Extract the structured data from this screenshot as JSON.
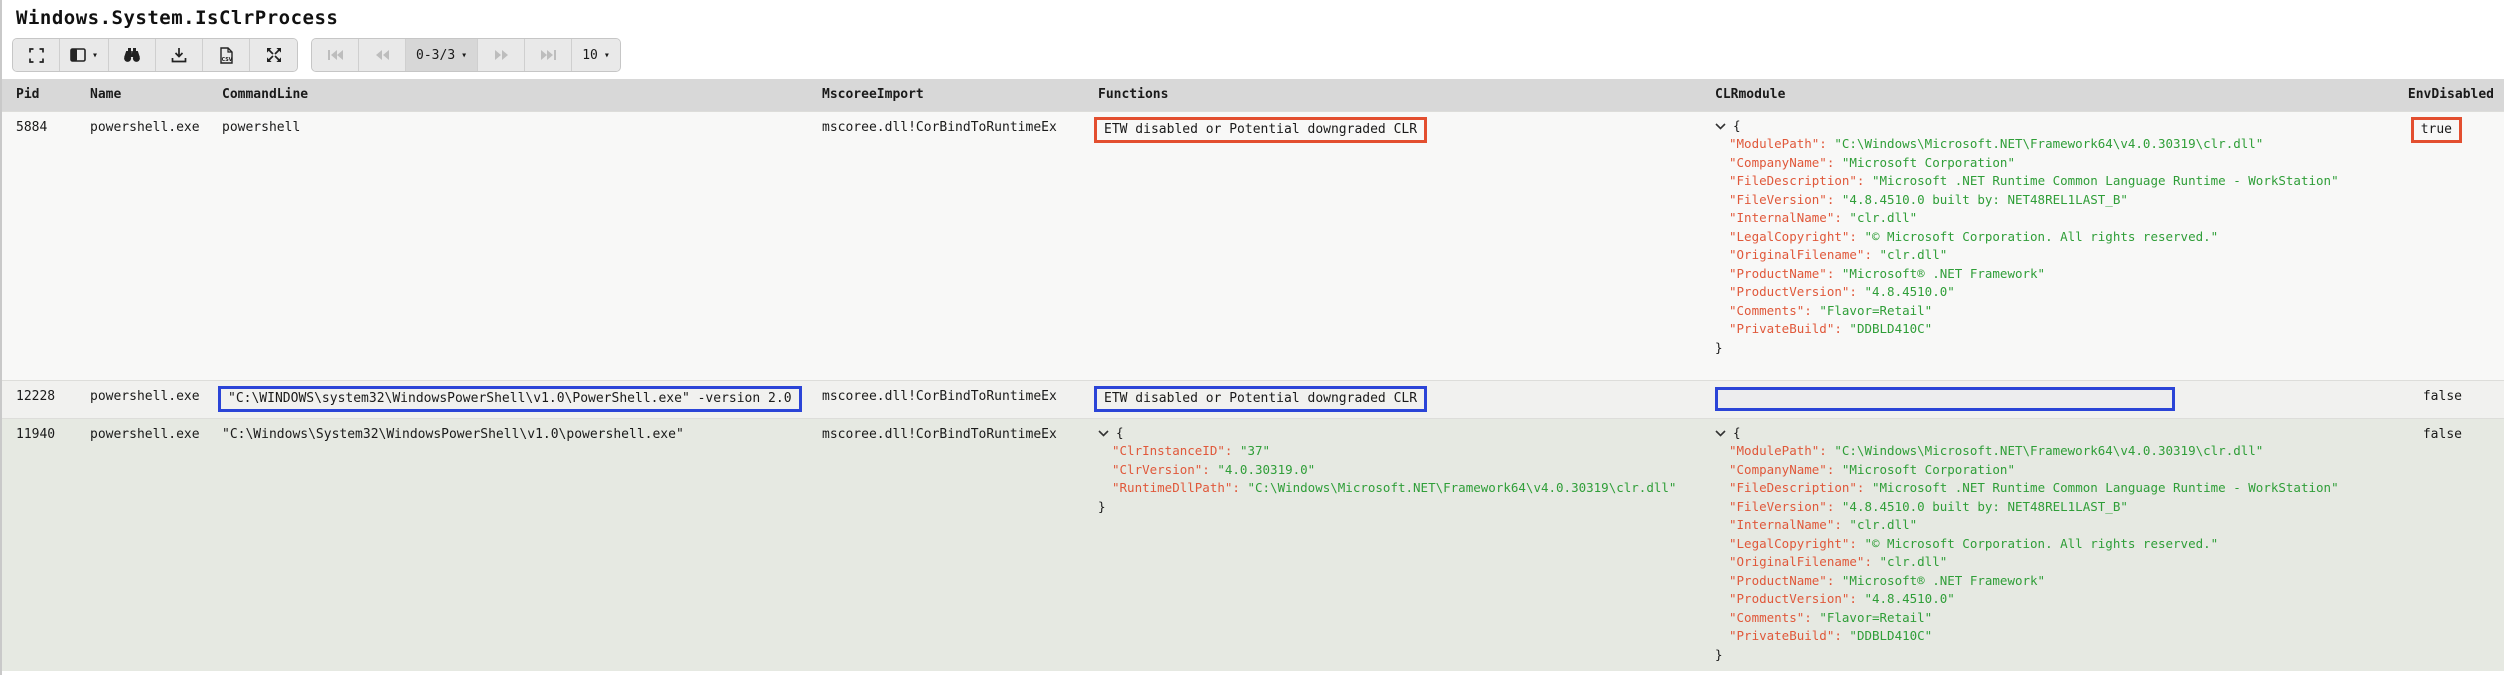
{
  "title": "Windows.System.IsClrProcess",
  "icons": {
    "caret_down": "▾"
  },
  "colors": {
    "flag_red": "#e34f2f",
    "flag_blue": "#2b44d7",
    "json_key": "#e0583a",
    "json_value": "#2f9e38",
    "header_bg": "#d8d8d8",
    "row3_bg": "#e6e9e2"
  },
  "toolbar": {
    "buttons": [
      {
        "name": "fullscreen",
        "icon": "fullscreen-icon"
      },
      {
        "name": "columns",
        "icon": "columns-icon"
      },
      {
        "name": "search",
        "icon": "binoculars-icon"
      },
      {
        "name": "download",
        "icon": "download-icon"
      },
      {
        "name": "export-csv",
        "icon": "csv-file-icon"
      },
      {
        "name": "expand",
        "icon": "arrows-expand-icon"
      }
    ],
    "pagination": {
      "range_label": "0-3/3",
      "page_size_label": "10"
    }
  },
  "table": {
    "columns": [
      "Pid",
      "Name",
      "CommandLine",
      "MscoreeImport",
      "Functions",
      "CLRmodule",
      "EnvDisabled"
    ],
    "rows": [
      {
        "pid": "5884",
        "name": "powershell.exe",
        "commandline": {
          "text": "powershell",
          "box": null
        },
        "mscoree": "mscoree.dll!CorBindToRuntimeEx",
        "functions": {
          "text": "ETW disabled or Potential downgraded CLR",
          "box": "red"
        },
        "clrmodule": {
          "json": [
            {
              "k": "ModulePath",
              "v": "C:\\Windows\\Microsoft.NET\\Framework64\\v4.0.30319\\clr.dll"
            },
            {
              "k": "CompanyName",
              "v": "Microsoft Corporation"
            },
            {
              "k": "FileDescription",
              "v": "Microsoft .NET Runtime Common Language Runtime - WorkStation"
            },
            {
              "k": "FileVersion",
              "v": "4.8.4510.0 built by: NET48REL1LAST_B"
            },
            {
              "k": "InternalName",
              "v": "clr.dll"
            },
            {
              "k": "LegalCopyright",
              "v": "© Microsoft Corporation. All rights reserved."
            },
            {
              "k": "OriginalFilename",
              "v": "clr.dll"
            },
            {
              "k": "ProductName",
              "v": "Microsoft® .NET Framework"
            },
            {
              "k": "ProductVersion",
              "v": "4.8.4510.0"
            },
            {
              "k": "Comments",
              "v": "Flavor=Retail"
            },
            {
              "k": "PrivateBuild",
              "v": "DDBLD410C"
            }
          ]
        },
        "envdisabled": {
          "text": "true",
          "box": "red"
        }
      },
      {
        "pid": "12228",
        "name": "powershell.exe",
        "commandline": {
          "text": "\"C:\\WINDOWS\\system32\\WindowsPowerShell\\v1.0\\PowerShell.exe\" -version 2.0",
          "box": "blue"
        },
        "mscoree": "mscoree.dll!CorBindToRuntimeEx",
        "functions": {
          "text": "ETW disabled or Potential downgraded CLR",
          "box": "blue"
        },
        "clrmodule": {
          "empty_box": "blue"
        },
        "envdisabled": {
          "text": "false",
          "box": null
        }
      },
      {
        "pid": "11940",
        "name": "powershell.exe",
        "commandline": {
          "text": "\"C:\\Windows\\System32\\WindowsPowerShell\\v1.0\\powershell.exe\"",
          "box": null
        },
        "mscoree": "mscoree.dll!CorBindToRuntimeEx",
        "functions": {
          "json": [
            {
              "k": "ClrInstanceID",
              "v": "37"
            },
            {
              "k": "ClrVersion",
              "v": "4.0.30319.0"
            },
            {
              "k": "RuntimeDllPath",
              "v": "C:\\Windows\\Microsoft.NET\\Framework64\\v4.0.30319\\clr.dll"
            }
          ]
        },
        "clrmodule": {
          "json": [
            {
              "k": "ModulePath",
              "v": "C:\\Windows\\Microsoft.NET\\Framework64\\v4.0.30319\\clr.dll"
            },
            {
              "k": "CompanyName",
              "v": "Microsoft Corporation"
            },
            {
              "k": "FileDescription",
              "v": "Microsoft .NET Runtime Common Language Runtime - WorkStation"
            },
            {
              "k": "FileVersion",
              "v": "4.8.4510.0 built by: NET48REL1LAST_B"
            },
            {
              "k": "InternalName",
              "v": "clr.dll"
            },
            {
              "k": "LegalCopyright",
              "v": "© Microsoft Corporation. All rights reserved."
            },
            {
              "k": "OriginalFilename",
              "v": "clr.dll"
            },
            {
              "k": "ProductName",
              "v": "Microsoft® .NET Framework"
            },
            {
              "k": "ProductVersion",
              "v": "4.8.4510.0"
            },
            {
              "k": "Comments",
              "v": "Flavor=Retail"
            },
            {
              "k": "PrivateBuild",
              "v": "DDBLD410C"
            }
          ]
        },
        "envdisabled": {
          "text": "false",
          "box": null
        }
      }
    ]
  }
}
